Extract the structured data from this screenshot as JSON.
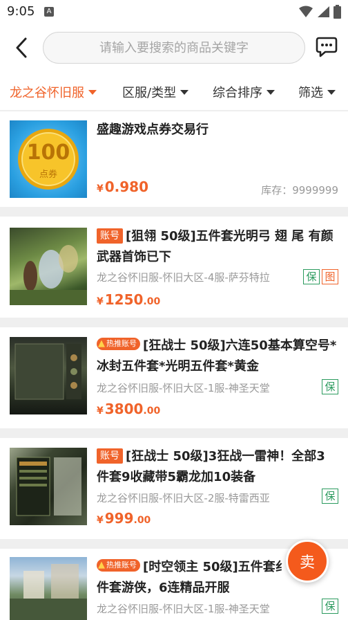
{
  "status": {
    "time": "9:05",
    "app_icon": "A"
  },
  "search": {
    "placeholder": "请输入要搜索的商品关键字"
  },
  "filters": [
    {
      "label": "龙之谷怀旧服",
      "active": true
    },
    {
      "label": "区服/类型"
    },
    {
      "label": "综合排序"
    },
    {
      "label": "筛选"
    }
  ],
  "listings": [
    {
      "title": "盛趣游戏点券交易行",
      "thumb_text": "100",
      "thumb_sub": "点券",
      "price_symbol": "¥",
      "price_int": "0.980",
      "price_dec": "",
      "stock": "库存：9999999"
    },
    {
      "tag": "账号",
      "title": "[狙翎 50级]五件套光明弓 翅 尾 有颜 武器首饰已下",
      "server": "龙之谷怀旧服-怀旧大区-4服-萨芬特拉",
      "price_symbol": "¥",
      "price_int": "1250",
      "price_dec": ".00",
      "badge_bao": "保",
      "badge_tu": "图"
    },
    {
      "tag": "热推账号",
      "title": "[狂战士 50级]六连50基本算空号*冰封五件套*光明五件套*黄金",
      "server": "龙之谷怀旧服-怀旧大区-1服-神圣天堂",
      "price_symbol": "¥",
      "price_int": "3800",
      "price_dec": ".00",
      "badge_bao": "保"
    },
    {
      "tag": "账号",
      "title": "[狂战士 50级]3狂战一雷神！全部3件套9收藏带5霸龙加10装备",
      "server": "龙之谷怀旧服-怀旧大区-2服-特雷西亚",
      "price_symbol": "¥",
      "price_int": "999",
      "price_dec": ".00",
      "badge_bao": "保"
    },
    {
      "tag": "热推账号",
      "title": "[时空领主 50级]五件套纟导，三件套游侠，6连精品开服",
      "server": "龙之谷怀旧服-怀旧大区-1服-神圣天堂",
      "badge_bao": "保"
    }
  ],
  "sell_button": "卖",
  "colors": {
    "accent": "#f0632a",
    "green": "#2a9a5d"
  }
}
